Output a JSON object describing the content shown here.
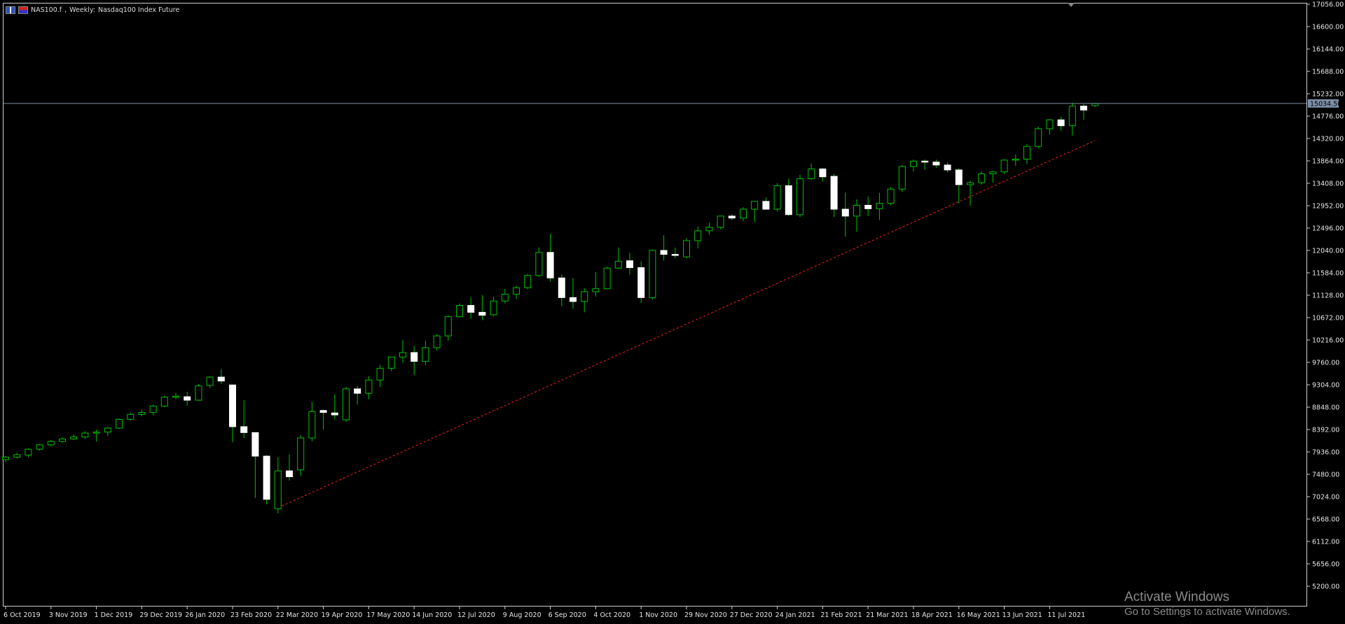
{
  "header": {
    "symbol": "NAS100.f",
    "timeframe": "Weekly:",
    "description": "Nasdaq100 Index Future"
  },
  "watermark": {
    "line1": "Activate Windows",
    "line2": "Go to Settings to activate Windows."
  },
  "colors": {
    "background": "#000000",
    "frame": "#cfcfcf",
    "candle_up": "#00c000",
    "candle_down_fill": "#ffffff",
    "wick": "#00c000",
    "trendline": "#ff2020",
    "bid_line": "#7d8fa8",
    "price_label_bg": "#7d8fa8"
  },
  "price_axis": {
    "ticks": [
      "17056.00",
      "16600.00",
      "16144.00",
      "15688.00",
      "15232.00",
      "14776.00",
      "14320.00",
      "13864.00",
      "13408.00",
      "12952.00",
      "12496.00",
      "12040.00",
      "11584.00",
      "11128.00",
      "10672.00",
      "10216.00",
      "9760.00",
      "9304.00",
      "8848.00",
      "8392.00",
      "7936.00",
      "7480.00",
      "7024.00",
      "6568.00",
      "6112.00",
      "5656.00",
      "5200.00"
    ],
    "current_price": "15034.50",
    "current_value": 15034.5
  },
  "time_axis": {
    "labels": [
      "6 Oct 2019",
      "3 Nov 2019",
      "1 Dec 2019",
      "29 Dec 2019",
      "26 Jan 2020",
      "23 Feb 2020",
      "22 Mar 2020",
      "19 Apr 2020",
      "17 May 2020",
      "14 Jun 2020",
      "12 Jul 2020",
      "9 Aug 2020",
      "6 Sep 2020",
      "4 Oct 2020",
      "1 Nov 2020",
      "29 Nov 2020",
      "27 Dec 2020",
      "24 Jan 2021",
      "21 Feb 2021",
      "21 Mar 2021",
      "18 Apr 2021",
      "16 May 2021",
      "13 Jun 2021",
      "11 Jul 2021"
    ]
  },
  "chart_data": {
    "type": "candlestick",
    "symbol": "NAS100.f",
    "timeframe": "Weekly",
    "ylim": [
      5000,
      17056
    ],
    "candles": [
      {
        "o": 7780,
        "h": 7850,
        "l": 7730,
        "c": 7830
      },
      {
        "o": 7830,
        "h": 7920,
        "l": 7800,
        "c": 7880
      },
      {
        "o": 7870,
        "h": 8010,
        "l": 7820,
        "c": 7990
      },
      {
        "o": 7990,
        "h": 8100,
        "l": 7960,
        "c": 8080
      },
      {
        "o": 8080,
        "h": 8180,
        "l": 8050,
        "c": 8150
      },
      {
        "o": 8150,
        "h": 8230,
        "l": 8120,
        "c": 8200
      },
      {
        "o": 8200,
        "h": 8290,
        "l": 8180,
        "c": 8240
      },
      {
        "o": 8240,
        "h": 8360,
        "l": 8200,
        "c": 8320
      },
      {
        "o": 8320,
        "h": 8390,
        "l": 8150,
        "c": 8340
      },
      {
        "o": 8340,
        "h": 8450,
        "l": 8260,
        "c": 8420
      },
      {
        "o": 8420,
        "h": 8620,
        "l": 8400,
        "c": 8600
      },
      {
        "o": 8600,
        "h": 8740,
        "l": 8580,
        "c": 8700
      },
      {
        "o": 8700,
        "h": 8800,
        "l": 8660,
        "c": 8740
      },
      {
        "o": 8740,
        "h": 8900,
        "l": 8680,
        "c": 8870
      },
      {
        "o": 8870,
        "h": 9080,
        "l": 8850,
        "c": 9050
      },
      {
        "o": 9050,
        "h": 9140,
        "l": 9010,
        "c": 9070
      },
      {
        "o": 9060,
        "h": 9160,
        "l": 8880,
        "c": 8990
      },
      {
        "o": 8990,
        "h": 9320,
        "l": 8980,
        "c": 9280
      },
      {
        "o": 9290,
        "h": 9480,
        "l": 9240,
        "c": 9460
      },
      {
        "o": 9460,
        "h": 9620,
        "l": 9320,
        "c": 9380
      },
      {
        "o": 9300,
        "h": 9310,
        "l": 8130,
        "c": 8450
      },
      {
        "o": 8450,
        "h": 8990,
        "l": 8220,
        "c": 8330
      },
      {
        "o": 8330,
        "h": 8330,
        "l": 7000,
        "c": 7850
      },
      {
        "o": 7850,
        "h": 7870,
        "l": 6870,
        "c": 6970
      },
      {
        "o": 6780,
        "h": 7830,
        "l": 6680,
        "c": 7550
      },
      {
        "o": 7550,
        "h": 7880,
        "l": 7350,
        "c": 7430
      },
      {
        "o": 7570,
        "h": 8280,
        "l": 7450,
        "c": 8220
      },
      {
        "o": 8220,
        "h": 8950,
        "l": 8150,
        "c": 8760
      },
      {
        "o": 8780,
        "h": 8800,
        "l": 8390,
        "c": 8740
      },
      {
        "o": 8730,
        "h": 9110,
        "l": 8600,
        "c": 8690
      },
      {
        "o": 8590,
        "h": 9260,
        "l": 8550,
        "c": 9220
      },
      {
        "o": 9220,
        "h": 9280,
        "l": 8900,
        "c": 9130
      },
      {
        "o": 9130,
        "h": 9480,
        "l": 9010,
        "c": 9400
      },
      {
        "o": 9400,
        "h": 9710,
        "l": 9260,
        "c": 9640
      },
      {
        "o": 9640,
        "h": 9880,
        "l": 9580,
        "c": 9870
      },
      {
        "o": 9870,
        "h": 10220,
        "l": 9750,
        "c": 9960
      },
      {
        "o": 9960,
        "h": 10100,
        "l": 9500,
        "c": 9780
      },
      {
        "o": 9780,
        "h": 10200,
        "l": 9700,
        "c": 10060
      },
      {
        "o": 10060,
        "h": 10330,
        "l": 10000,
        "c": 10300
      },
      {
        "o": 10300,
        "h": 10720,
        "l": 10200,
        "c": 10690
      },
      {
        "o": 10690,
        "h": 10960,
        "l": 10670,
        "c": 10920
      },
      {
        "o": 10920,
        "h": 11080,
        "l": 10650,
        "c": 10780
      },
      {
        "o": 10780,
        "h": 11130,
        "l": 10620,
        "c": 10720
      },
      {
        "o": 10730,
        "h": 11100,
        "l": 10700,
        "c": 11010
      },
      {
        "o": 11010,
        "h": 11260,
        "l": 10960,
        "c": 11150
      },
      {
        "o": 11150,
        "h": 11320,
        "l": 11050,
        "c": 11280
      },
      {
        "o": 11280,
        "h": 11560,
        "l": 11250,
        "c": 11530
      },
      {
        "o": 11530,
        "h": 12100,
        "l": 11500,
        "c": 12000
      },
      {
        "o": 12000,
        "h": 12380,
        "l": 11400,
        "c": 11480
      },
      {
        "o": 11480,
        "h": 11550,
        "l": 10900,
        "c": 11080
      },
      {
        "o": 11080,
        "h": 11480,
        "l": 10850,
        "c": 11000
      },
      {
        "o": 11000,
        "h": 11270,
        "l": 10780,
        "c": 11200
      },
      {
        "o": 11200,
        "h": 11600,
        "l": 11100,
        "c": 11260
      },
      {
        "o": 11260,
        "h": 11710,
        "l": 11250,
        "c": 11680
      },
      {
        "o": 11680,
        "h": 12100,
        "l": 11660,
        "c": 11820
      },
      {
        "o": 11830,
        "h": 11990,
        "l": 11550,
        "c": 11690
      },
      {
        "o": 11690,
        "h": 11820,
        "l": 10970,
        "c": 11080
      },
      {
        "o": 11080,
        "h": 12060,
        "l": 11040,
        "c": 12040
      },
      {
        "o": 12040,
        "h": 12350,
        "l": 11830,
        "c": 11960
      },
      {
        "o": 11960,
        "h": 12100,
        "l": 11880,
        "c": 11940
      },
      {
        "o": 11910,
        "h": 12290,
        "l": 11880,
        "c": 12240
      },
      {
        "o": 12240,
        "h": 12530,
        "l": 12080,
        "c": 12440
      },
      {
        "o": 12440,
        "h": 12610,
        "l": 12360,
        "c": 12510
      },
      {
        "o": 12510,
        "h": 12750,
        "l": 12470,
        "c": 12740
      },
      {
        "o": 12740,
        "h": 12780,
        "l": 12660,
        "c": 12700
      },
      {
        "o": 12700,
        "h": 12920,
        "l": 12640,
        "c": 12880
      },
      {
        "o": 12880,
        "h": 13040,
        "l": 12620,
        "c": 13040
      },
      {
        "o": 13040,
        "h": 13120,
        "l": 12880,
        "c": 12880
      },
      {
        "o": 12880,
        "h": 13410,
        "l": 12830,
        "c": 13360
      },
      {
        "o": 13360,
        "h": 13500,
        "l": 12750,
        "c": 12770
      },
      {
        "o": 12770,
        "h": 13580,
        "l": 12720,
        "c": 13500
      },
      {
        "o": 13500,
        "h": 13810,
        "l": 13480,
        "c": 13700
      },
      {
        "o": 13700,
        "h": 13720,
        "l": 13450,
        "c": 13540
      },
      {
        "o": 13550,
        "h": 13600,
        "l": 12720,
        "c": 12880
      },
      {
        "o": 12880,
        "h": 13220,
        "l": 12320,
        "c": 12740
      },
      {
        "o": 12740,
        "h": 13080,
        "l": 12420,
        "c": 12960
      },
      {
        "o": 12960,
        "h": 13140,
        "l": 12740,
        "c": 12890
      },
      {
        "o": 12890,
        "h": 13210,
        "l": 12660,
        "c": 13000
      },
      {
        "o": 13000,
        "h": 13330,
        "l": 12960,
        "c": 13290
      },
      {
        "o": 13290,
        "h": 13780,
        "l": 13230,
        "c": 13750
      },
      {
        "o": 13750,
        "h": 13890,
        "l": 13650,
        "c": 13860
      },
      {
        "o": 13860,
        "h": 13890,
        "l": 13680,
        "c": 13840
      },
      {
        "o": 13840,
        "h": 13890,
        "l": 13720,
        "c": 13780
      },
      {
        "o": 13780,
        "h": 13830,
        "l": 13630,
        "c": 13680
      },
      {
        "o": 13680,
        "h": 13710,
        "l": 13000,
        "c": 13380
      },
      {
        "o": 13380,
        "h": 13460,
        "l": 12950,
        "c": 13420
      },
      {
        "o": 13420,
        "h": 13650,
        "l": 13380,
        "c": 13600
      },
      {
        "o": 13600,
        "h": 13660,
        "l": 13420,
        "c": 13640
      },
      {
        "o": 13640,
        "h": 13900,
        "l": 13600,
        "c": 13880
      },
      {
        "o": 13880,
        "h": 14000,
        "l": 13760,
        "c": 13900
      },
      {
        "o": 13900,
        "h": 14210,
        "l": 13800,
        "c": 14160
      },
      {
        "o": 14160,
        "h": 14560,
        "l": 14120,
        "c": 14520
      },
      {
        "o": 14520,
        "h": 14720,
        "l": 14400,
        "c": 14700
      },
      {
        "o": 14700,
        "h": 14760,
        "l": 14480,
        "c": 14580
      },
      {
        "o": 14580,
        "h": 15050,
        "l": 14380,
        "c": 14980
      },
      {
        "o": 14980,
        "h": 15020,
        "l": 14700,
        "c": 14900
      },
      {
        "o": 14990,
        "h": 15050,
        "l": 14960,
        "c": 15034.5
      }
    ],
    "trendline": {
      "from": {
        "index": 24,
        "price": 6800
      },
      "to": {
        "index": 96,
        "price": 14280
      },
      "style": "dashed"
    }
  }
}
